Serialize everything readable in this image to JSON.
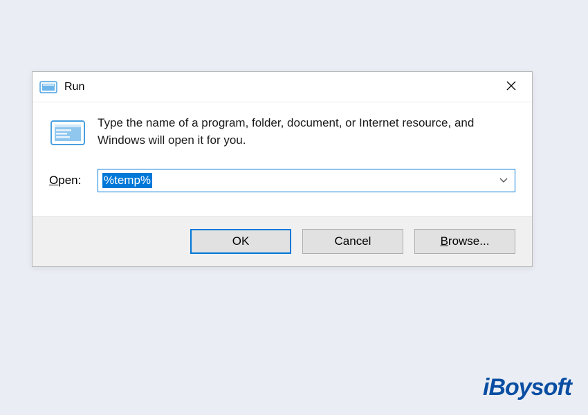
{
  "dialog": {
    "title": "Run",
    "description": "Type the name of a program, folder, document, or Internet resource, and Windows will open it for you.",
    "open_label_accesskey": "O",
    "open_label_rest": "pen:",
    "input_value": "%temp%",
    "buttons": {
      "ok": "OK",
      "cancel": "Cancel",
      "browse_accesskey": "B",
      "browse_rest": "rowse..."
    }
  },
  "watermark": "iBoysoft"
}
